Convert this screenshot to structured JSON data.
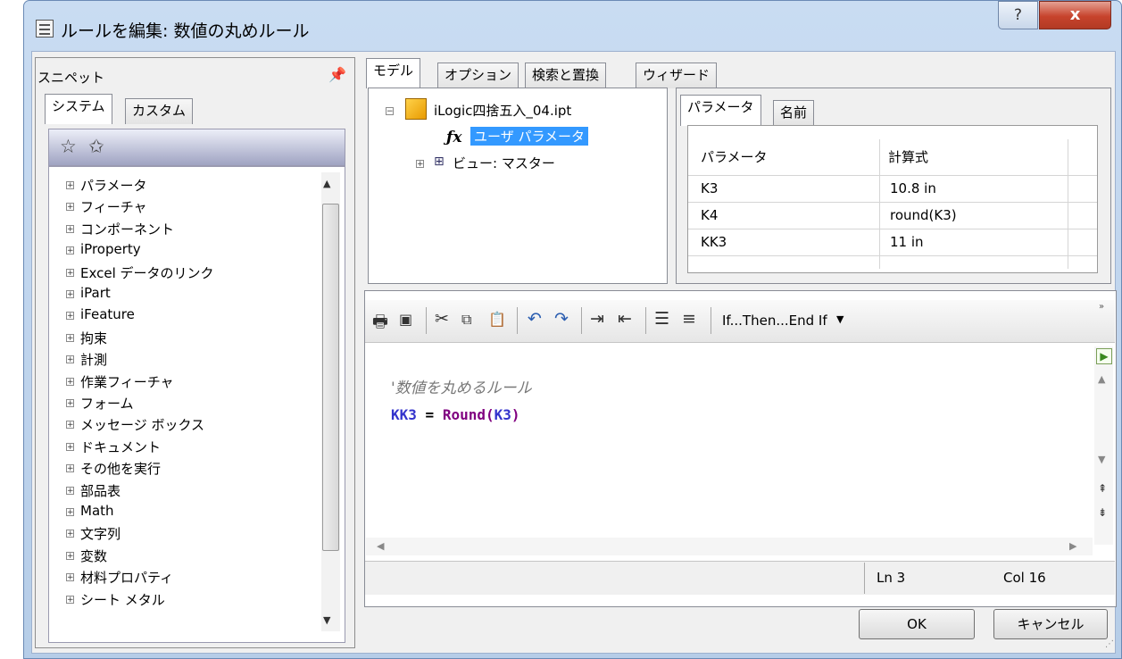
{
  "window": {
    "title": "ルールを編集: 数値の丸めルール",
    "help_label": "?",
    "close_label": "x"
  },
  "snippets": {
    "title": "スニペット",
    "tabs": [
      "システム",
      "カスタム"
    ],
    "items": [
      "パラメータ",
      "フィーチャ",
      "コンポーネント",
      "iProperty",
      "Excel データのリンク",
      "iPart",
      "iFeature",
      "拘束",
      "計測",
      "作業フィーチャ",
      "フォーム",
      "メッセージ ボックス",
      "ドキュメント",
      "その他を実行",
      "部品表",
      "Math",
      "文字列",
      "変数",
      "材料プロパティ",
      "シート メタル"
    ]
  },
  "main_tabs": [
    "モデル",
    "オプション",
    "検索と置換",
    "ウィザード"
  ],
  "model_tree": {
    "file": "iLogic四捨五入_04.ipt",
    "user_params": "ユーザ パラメータ",
    "view": "ビュー: マスター"
  },
  "param_tabs": [
    "パラメータ",
    "名前"
  ],
  "param_table": {
    "headers": [
      "パラメータ",
      "計算式"
    ],
    "rows": [
      [
        "K3",
        "10.8 in"
      ],
      [
        "K4",
        "round(K3)"
      ],
      [
        "KK3",
        "11 in"
      ]
    ]
  },
  "editor": {
    "template_label": "If...Then...End If",
    "comment": "'数値を丸めるルール",
    "code_var": "KK3",
    "code_eq": " = ",
    "code_fn": "Round",
    "code_paren_open": "(",
    "code_arg": "K3",
    "code_paren_close": ")",
    "status_ln": "Ln 3",
    "status_col": "Col 16"
  },
  "buttons": {
    "ok": "OK",
    "cancel": "キャンセル"
  },
  "colors": {
    "selection": "#3399ff",
    "code_var": "#3333cc",
    "code_fn": "#800080",
    "close": "#c7432c"
  }
}
